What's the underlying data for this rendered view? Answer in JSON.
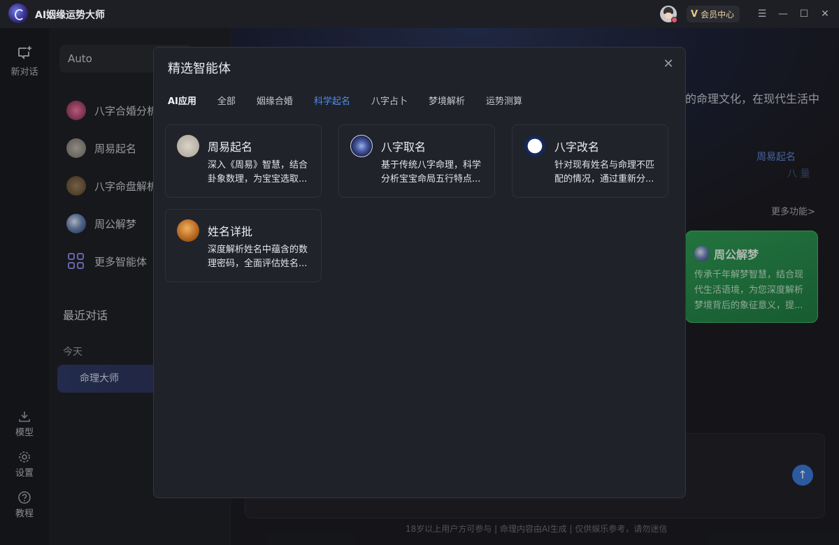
{
  "app": {
    "title": "AI姻缘运势大师",
    "vip_label": "会员中心",
    "vip_mark": "V",
    "window_controls": [
      "☰",
      "—",
      "☐",
      "✕"
    ]
  },
  "rail": {
    "new_chat": "新对话",
    "model": "模型",
    "settings": "设置",
    "tutorial": "教程"
  },
  "sidebar": {
    "model_select": "Auto",
    "items": [
      {
        "label": "八字合婚分析",
        "icon": "pink-flower-icon"
      },
      {
        "label": "周易起名",
        "icon": "zhouyi-icon"
      },
      {
        "label": "八字命盘解析",
        "icon": "bazi-pan-icon"
      },
      {
        "label": "周公解梦",
        "icon": "dream-icon"
      },
      {
        "label": "更多智能体",
        "icon": "grid-icon"
      }
    ],
    "recent_title": "最近对话",
    "today_label": "今天",
    "recent_item": "命理大师"
  },
  "main": {
    "hero_text": "的命理文化，在现代生活中",
    "hero_link": "周易起名",
    "hero_link2": "八 量",
    "more_link": "更多功能>",
    "green_card": {
      "title": "周公解梦",
      "desc": "传承千年解梦智慧，结合现代生活语境，为您深度解析梦境背后的象征意义，提..."
    },
    "footer_note": "18岁以上用户方可参与 | 命理内容由AI生成 | 仅供娱乐参考，请勿迷信"
  },
  "modal": {
    "title": "精选智能体",
    "tabs": [
      "AI应用",
      "全部",
      "姻缘合婚",
      "科学起名",
      "八字占卜",
      "梦境解析",
      "运势测算"
    ],
    "active_tab": "科学起名",
    "cards": [
      {
        "title": "周易起名",
        "desc": "深入《周易》智慧，结合卦象数理，为宝宝选取..."
      },
      {
        "title": "八字取名",
        "desc": "基于传统八字命理，科学分析宝宝命局五行特点..."
      },
      {
        "title": "八字改名",
        "desc": "针对现有姓名与命理不匹配的情况，通过重新分..."
      },
      {
        "title": "姓名详批",
        "desc": "深度解析姓名中蕴含的数理密码，全面评估姓名..."
      }
    ]
  }
}
